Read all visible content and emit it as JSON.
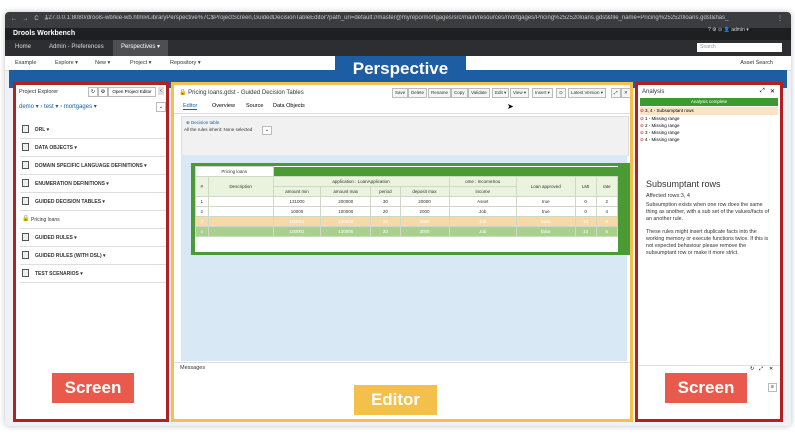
{
  "browser": {
    "nav": "← → C ⌂",
    "url": "127.0.0.1:8080/drools-wb/kie-wb.html#LibraryPerspective%7C$ProjectScreen,GuidedDecisionTableEditor?path_uri=default://master@myrepo/mortgages/src/main/resources/mortgages/Pricing%252520loans.gdst&file_name=Pricing%252520loans.gdst&has_",
    "menu": "⋮"
  },
  "app": {
    "brand": "Drools Workbench",
    "nav": [
      "Home",
      "Admin - Preferences",
      "Perspectives ▾"
    ],
    "search_placeholder": "Search",
    "user": "? ⚙ ⊙ 👤 admin ▾"
  },
  "toolbar": {
    "items": [
      "Example",
      "Explore ▾",
      "New ▾",
      "Project ▾",
      "Repository ▾"
    ],
    "right": "Asset Search"
  },
  "overlay": {
    "perspective": "Perspective",
    "screen_left": "Screen",
    "editor": "Editor",
    "screen_right": "Screen"
  },
  "explorer": {
    "title": "Project Explorer",
    "open_editor": "Open Project Editor",
    "breadcrumb": [
      "demo ▾",
      "test ▾",
      "mortgages ▾"
    ],
    "items": [
      "DRL ▾",
      "DATA OBJECTS ▾",
      "DOMAIN SPECIFIC LANGUAGE DEFINITIONS ▾",
      "ENUMERATION DEFINITIONS ▾",
      "GUIDED DECISION TABLES ▾",
      "Pricing loans",
      "GUIDED RULES ▾",
      "GUIDED RULES (WITH DSL) ▾",
      "TEST SCENARIOS ▾"
    ]
  },
  "editor": {
    "title": "Pricing loans.gdst - Guided Decision Tables",
    "buttons": [
      "Save",
      "Delete",
      "Rename",
      "Copy",
      "Validate",
      "Edit ▾",
      "View ▾",
      "Insert ▾",
      "⊙",
      "Latest Version ▾"
    ],
    "tabs": [
      "Editor",
      "Overview",
      "Source",
      "Data Objects"
    ],
    "decision_table": "⊕ Decision table",
    "rules_inherit": "All the rules inherit: None selected",
    "messages": "Messages",
    "table": {
      "name": "Pricing loans",
      "group_application": "application : LoanApplication",
      "group_income": "ome : IncomeSou",
      "headers": [
        "#",
        "Description",
        "amount min",
        "amount max",
        "period",
        "deposit max",
        "income",
        "Loan approved",
        "LMI",
        "rate"
      ],
      "rows": [
        [
          "1",
          "",
          "131000",
          "200000",
          "30",
          "20000",
          "Asset",
          "true",
          "0",
          "2"
        ],
        [
          "2",
          "",
          "10000",
          "100000",
          "20",
          "2000",
          "Job",
          "true",
          "0",
          "4"
        ],
        [
          "3",
          "",
          "100001",
          "130000",
          "20",
          "3000",
          "Job",
          "false",
          "10",
          "6"
        ],
        [
          "4",
          "",
          "100001",
          "130000",
          "20",
          "3000",
          "Job",
          "false",
          "10",
          "6"
        ]
      ]
    }
  },
  "analysis": {
    "title": "Analysis",
    "status": "Analysis complete",
    "issues": [
      "3, 4 - Subsumptant rows",
      "1 - Missing range",
      "2 - Missing range",
      "3 - Missing range",
      "4 - Missing range"
    ],
    "heading": "Subsumptant rows",
    "affected": "Affected rows:3, 4",
    "para1": "Subsumption exists when one row does the same thing as another, with a sub set of the values/facts of an another rule.",
    "para2": "These rules might insert duplicate facts into the working memory or execute functions twice. If this is not expected behaviour please remove the subsumptant row or make it more strict."
  }
}
